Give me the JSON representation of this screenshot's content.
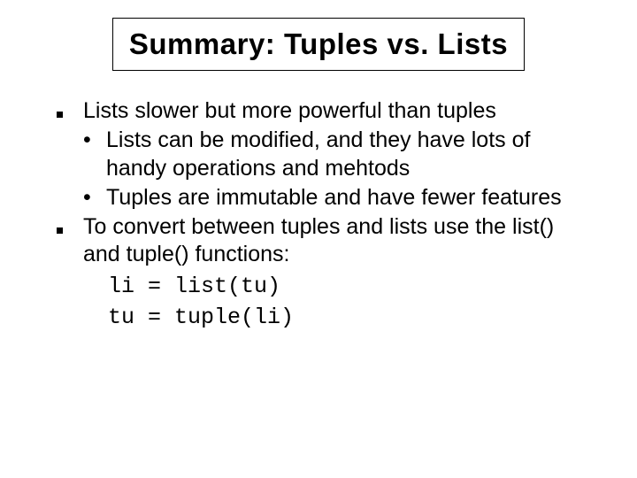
{
  "title": "Summary: Tuples vs. Lists",
  "bullets": [
    {
      "text": "Lists slower but more powerful than tuples",
      "subs": [
        "Lists can be modified, and they have lots of handy operations and mehtods",
        "Tuples are immutable and have fewer features"
      ]
    },
    {
      "text": "To convert between tuples and lists use the list() and tuple() functions:",
      "code": [
        "li = list(tu)",
        "tu = tuple(li)"
      ]
    }
  ]
}
